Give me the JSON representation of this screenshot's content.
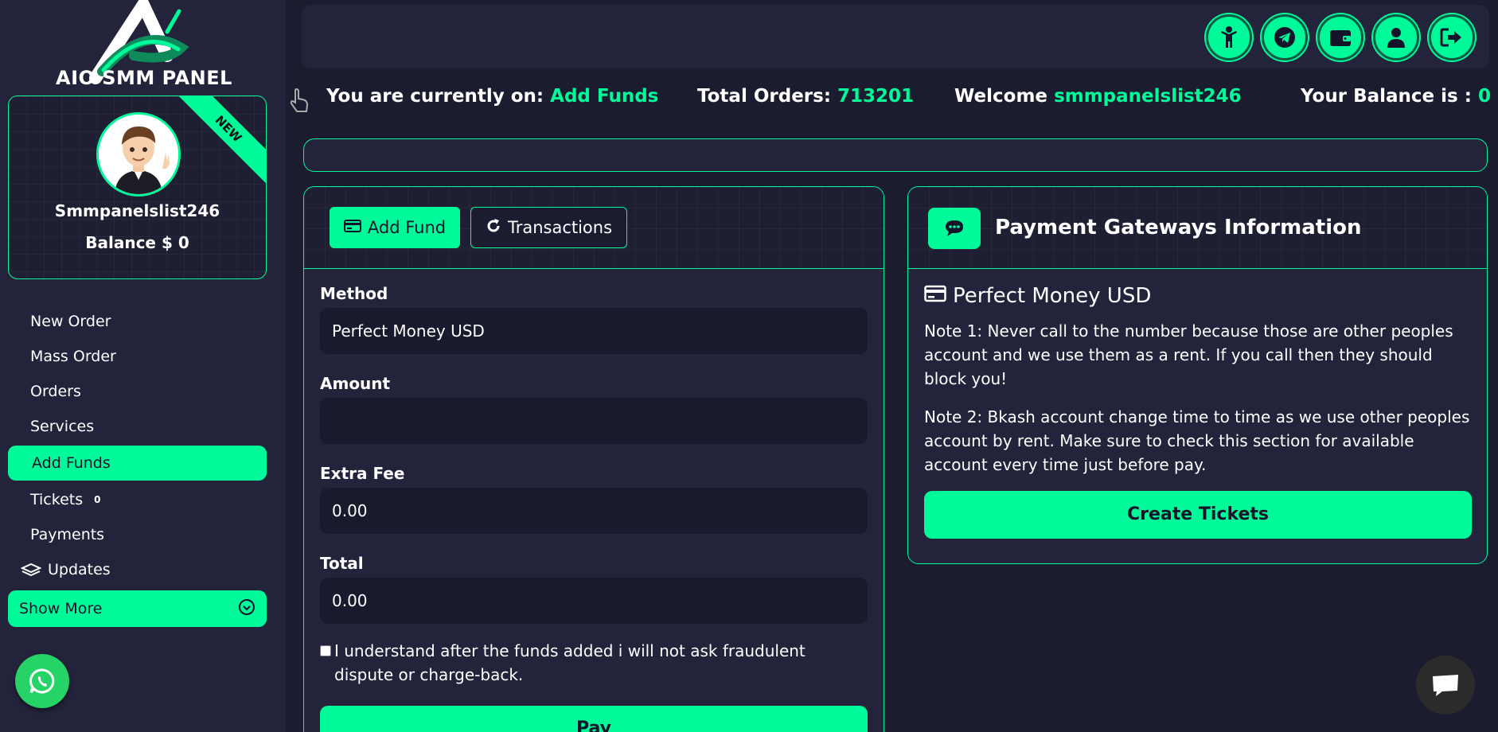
{
  "brand": {
    "name": "AIO SMM PANEL"
  },
  "profile": {
    "ribbon": "NEW",
    "username": "Smmpanelslist246",
    "balance": "Balance $ 0"
  },
  "sidebar": {
    "items": [
      {
        "label": "New Order"
      },
      {
        "label": "Mass Order"
      },
      {
        "label": "Orders"
      },
      {
        "label": "Services"
      },
      {
        "label": "Add Funds"
      },
      {
        "label": "Tickets",
        "badge": "0"
      },
      {
        "label": "Payments"
      },
      {
        "label": "Updates"
      }
    ],
    "show_more": "Show More"
  },
  "top_icons": [
    "child-icon",
    "telegram-icon",
    "wallet-icon",
    "user-icon",
    "logout-icon"
  ],
  "info": {
    "current_label": "You are currently on:",
    "current_page": "Add Funds",
    "orders_label": "Total Orders:",
    "orders_value": "713201",
    "welcome_label": "Welcome",
    "welcome_user": "smmpanelslist246",
    "balance_label": "Your Balance is :",
    "balance_value": "0"
  },
  "fund": {
    "tab_add": "Add Fund",
    "tab_transactions": "Transactions",
    "method_label": "Method",
    "method_value": "Perfect Money USD",
    "amount_label": "Amount",
    "amount_value": "",
    "fee_label": "Extra Fee",
    "fee_value": "0.00",
    "total_label": "Total",
    "total_value": "0.00",
    "agree_text": "I understand after the funds added i will not ask fraudulent dispute or charge-back.",
    "pay_label": "Pay"
  },
  "gateway": {
    "title": "Payment Gateways Information",
    "method": "Perfect Money USD",
    "note1": "Note 1: Never call to the number because those are other peoples account and we use them as a rent. If you call then they should block you!",
    "note2": "Note 2: Bkash account change time to time as we use other peoples account by rent. Make sure to check this section for available account every time just before pay.",
    "create_label": "Create Tickets"
  },
  "colors": {
    "accent": "#00fa9a",
    "background": "#1b1c30",
    "panel": "#23243b"
  }
}
